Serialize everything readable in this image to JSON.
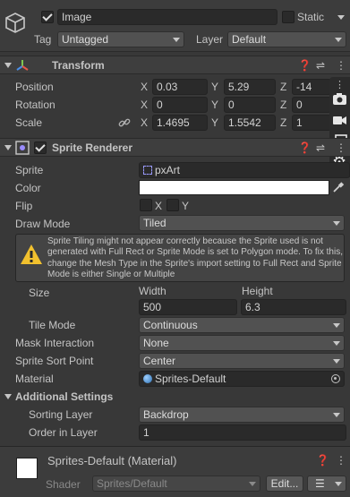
{
  "gameobject": {
    "active": true,
    "name": "Image",
    "static_label": "Static",
    "tag_label": "Tag",
    "tag_value": "Untagged",
    "layer_label": "Layer",
    "layer_value": "Default"
  },
  "transform": {
    "title": "Transform",
    "position": {
      "label": "Position",
      "x": "0.03",
      "y": "5.29",
      "z": "-14"
    },
    "rotation": {
      "label": "Rotation",
      "x": "0",
      "y": "0",
      "z": "0"
    },
    "scale": {
      "label": "Scale",
      "x": "1.4695",
      "y": "1.5542",
      "z": "1"
    },
    "axis": {
      "x": "X",
      "y": "Y",
      "z": "Z"
    }
  },
  "sprite_renderer": {
    "title": "Sprite Renderer",
    "enabled": true,
    "sprite_label": "Sprite",
    "sprite_value": "pxArt",
    "color_label": "Color",
    "color_value": "#ffffff",
    "flip_label": "Flip",
    "flip_x": "X",
    "flip_y": "Y",
    "draw_mode_label": "Draw Mode",
    "draw_mode_value": "Tiled",
    "warning_text": "Sprite Tiling might not appear correctly because the Sprite used is not generated with Full Rect or Sprite Mode is set to Polygon mode. To fix this, change the Mesh Type in the Sprite's import setting to Full Rect and Sprite Mode is either Single or Multiple",
    "size_label": "Size",
    "width_label": "Width",
    "height_label": "Height",
    "width_value": "500",
    "height_value": "6.3",
    "tile_mode_label": "Tile Mode",
    "tile_mode_value": "Continuous",
    "mask_label": "Mask Interaction",
    "mask_value": "None",
    "sort_point_label": "Sprite Sort Point",
    "sort_point_value": "Center",
    "material_label": "Material",
    "material_value": "Sprites-Default",
    "additional_label": "Additional Settings",
    "sorting_layer_label": "Sorting Layer",
    "sorting_layer_value": "Backdrop",
    "order_label": "Order in Layer",
    "order_value": "1"
  },
  "material_panel": {
    "name": "Sprites-Default (Material)",
    "shader_label": "Shader",
    "shader_value": "Sprites/Default",
    "edit_label": "Edit..."
  },
  "colors": {
    "background": "#383838",
    "header": "#3e3e3e",
    "field": "#2a2a2a",
    "dropdown": "#515151",
    "warning_icon": "#f2c12e"
  }
}
